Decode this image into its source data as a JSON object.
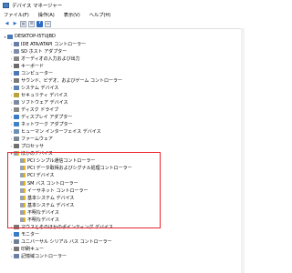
{
  "window": {
    "title": "デバイス マネージャー"
  },
  "menu": [
    "ファイル(F)",
    "操作(A)",
    "表示(V)",
    "ヘルプ(H)"
  ],
  "toolbar": {
    "icons": [
      "back-icon",
      "forward-icon",
      "properties-icon",
      "list-icon",
      "help-icon",
      "monitor-icon"
    ],
    "help_label": "?"
  },
  "tree": {
    "root": "DESKTOP-I5TUJBD",
    "items": [
      {
        "label": "IDE ATA/ATAPI コントローラー",
        "color": "#6b7fa8"
      },
      {
        "label": "SD ホスト アダプター",
        "color": "#7d8ea8"
      },
      {
        "label": "オーディオの入力および出力",
        "color": "#8a8a8a"
      },
      {
        "label": "キーボード",
        "color": "#6b6b6b"
      },
      {
        "label": "コンピューター",
        "color": "#4a78b8"
      },
      {
        "label": "サウンド、ビデオ、およびゲーム コントローラー",
        "color": "#7a7a7a"
      },
      {
        "label": "システム デバイス",
        "color": "#5b82b5"
      },
      {
        "label": "セキュリティ デバイス",
        "color": "#b8a33a"
      },
      {
        "label": "ソフトウェア デバイス",
        "color": "#7a8aa0"
      },
      {
        "label": "ディスク ドライブ",
        "color": "#888888"
      },
      {
        "label": "ディスプレイ アダプター",
        "color": "#3a7bc8"
      },
      {
        "label": "ネットワーク アダプター",
        "color": "#3f83c6"
      },
      {
        "label": "ヒューマン インターフェイス デバイス",
        "color": "#6c8fb8"
      },
      {
        "label": "ファームウェア",
        "color": "#7b8898"
      },
      {
        "label": "プロセッサ",
        "color": "#707070"
      }
    ],
    "expanded_group": {
      "label": "ほかのデバイス",
      "children": [
        {
          "label": "PCI シンプル通信コントローラー"
        },
        {
          "label": "PCI データ取得およびシグナル処理コントローラー"
        },
        {
          "label": "PCI デバイス"
        },
        {
          "label": "SM バス コントローラー"
        },
        {
          "label": "イーサネット コントローラー"
        },
        {
          "label": "基本システム デバイス"
        },
        {
          "label": "基本システム デバイス"
        },
        {
          "label": "不明なデバイス"
        },
        {
          "label": "不明なデバイス"
        }
      ]
    },
    "after_items": [
      {
        "label": "マウスとそのほかのポインティング デバイス",
        "color": "#777777"
      },
      {
        "label": "モニター",
        "color": "#3a7bc8"
      },
      {
        "label": "ユニバーサル シリアル バス コントローラー",
        "color": "#6f7f95"
      },
      {
        "label": "印刷キュー",
        "color": "#777777"
      },
      {
        "label": "記憶域コントローラー",
        "color": "#6b7fa8"
      }
    ],
    "warning_icon_color": "#e0b52a"
  },
  "highlight_color": "#e8262c"
}
